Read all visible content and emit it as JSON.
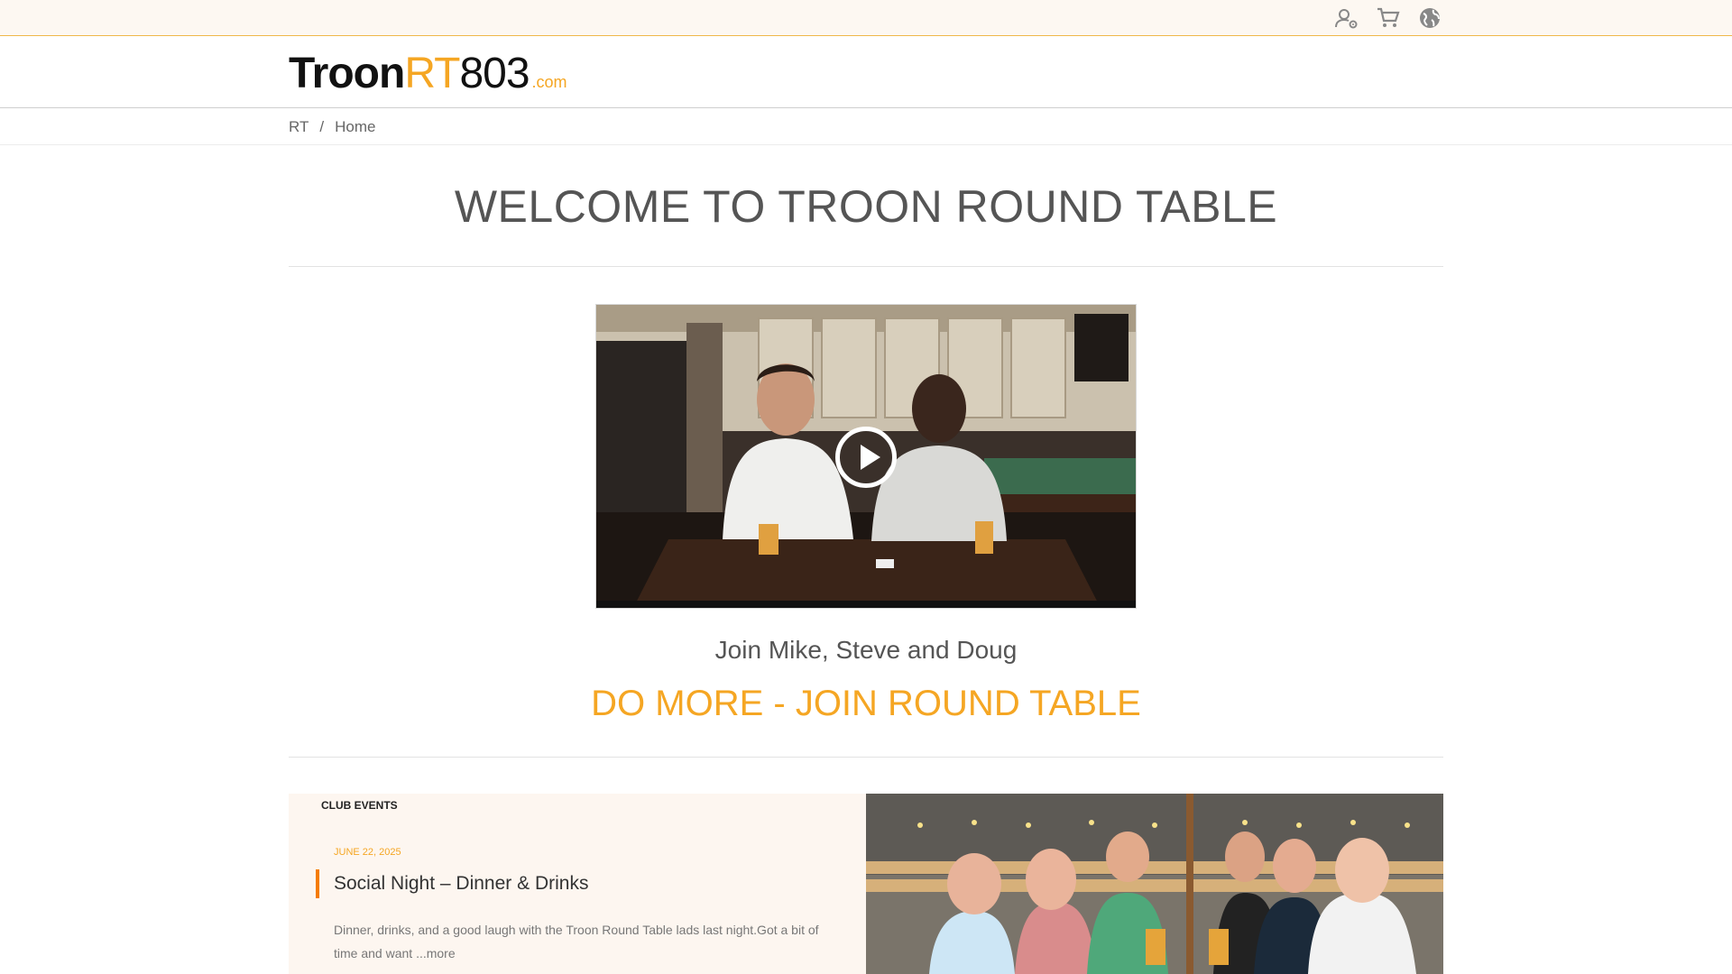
{
  "topbar": {
    "icons": [
      "user-settings-icon",
      "cart-icon",
      "globe-icon"
    ]
  },
  "logo": {
    "part1": "Troon",
    "part2": "RT",
    "part3": "803",
    "part4": ".com"
  },
  "breadcrumb": {
    "items": [
      "RT",
      "/",
      "Home"
    ]
  },
  "main": {
    "welcome": "WELCOME TO TROON ROUND TABLE",
    "join_text": "Join Mike, Steve and Doug",
    "cta": "DO MORE - JOIN ROUND TABLE"
  },
  "events": {
    "label": "CLUB EVENTS",
    "date": "JUNE 22, 2025",
    "title": "Social Night – Dinner & Drinks",
    "desc": "Dinner, drinks, and a good laugh with the Troon Round Table lads last night.Got a bit of time and want ",
    "more": "...more"
  },
  "colors": {
    "accent": "#f5a623",
    "accent_bar": "#f57c00",
    "topbar_bg": "#fdf8f2",
    "events_bg": "#fdf6f0"
  }
}
